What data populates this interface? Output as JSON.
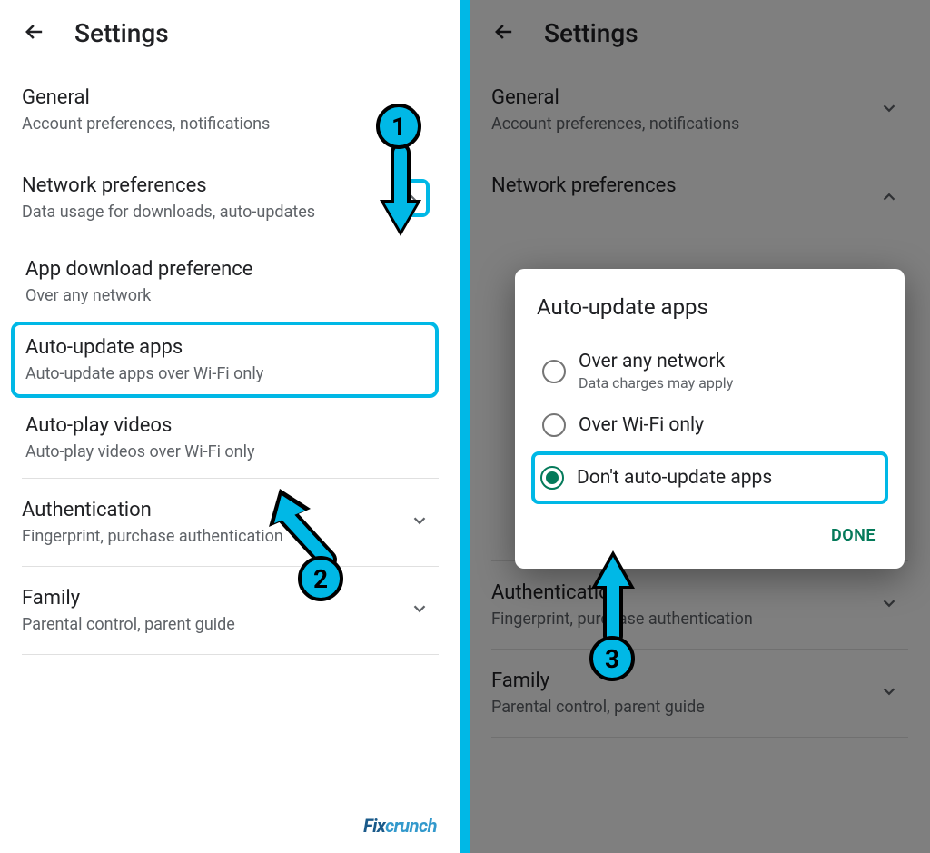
{
  "header": {
    "title": "Settings"
  },
  "sections": {
    "general": {
      "title": "General",
      "sub": "Account preferences, notifications"
    },
    "network": {
      "title": "Network preferences",
      "sub": "Data usage for downloads, auto-updates"
    },
    "appdl": {
      "title": "App download preference",
      "sub": "Over any network"
    },
    "autoUpdate": {
      "title": "Auto-update apps",
      "sub": "Auto-update apps over Wi-Fi only"
    },
    "autoPlay": {
      "title": "Auto-play videos",
      "sub": "Auto-play videos over Wi-Fi only"
    },
    "auth": {
      "title": "Authentication",
      "sub": "Fingerprint, purchase authentication"
    },
    "family": {
      "title": "Family",
      "sub": "Parental control, parent guide"
    }
  },
  "dialog": {
    "title": "Auto-update apps",
    "opt1": {
      "label": "Over any network",
      "sub": "Data charges may apply"
    },
    "opt2": {
      "label": "Over Wi-Fi only"
    },
    "opt3": {
      "label": "Don't auto-update apps"
    },
    "done": "DONE"
  },
  "badges": {
    "b1": "1",
    "b2": "2",
    "b3": "3"
  },
  "watermark": {
    "fix": "Fix",
    "crunch": "crunch"
  }
}
